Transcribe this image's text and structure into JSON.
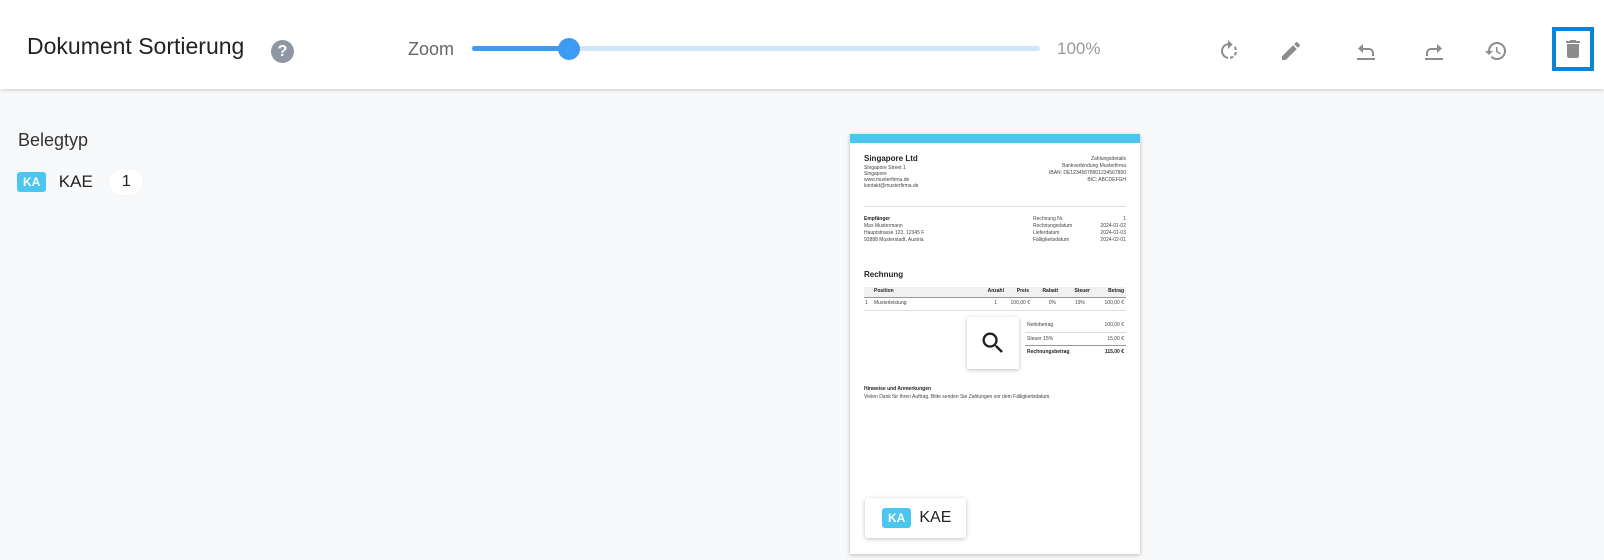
{
  "header": {
    "title": "Dokument Sortierung",
    "help_symbol": "?",
    "help_icon": "question-circle-icon",
    "zoom": {
      "label": "Zoom",
      "value_text": "100%",
      "slider_fraction": 0.17
    },
    "tools": [
      {
        "name": "rotate-icon"
      },
      {
        "name": "edit-pencil-icon"
      },
      {
        "name": "undo-icon"
      },
      {
        "name": "redo-icon"
      },
      {
        "name": "history-icon"
      },
      {
        "name": "delete-trash-icon"
      }
    ],
    "accent_color": "#3d9bf2",
    "highlight_color": "#0a84d6"
  },
  "sidebar": {
    "section_label": "Belegtyp",
    "types": [
      {
        "badge": "KA",
        "name": "KAE",
        "count": "1"
      }
    ],
    "badge_color": "#4cc6ee"
  },
  "document": {
    "page_tag": {
      "badge": "KA",
      "name": "KAE"
    },
    "zoom_icon": "magnifier-icon",
    "sender_name": "Singapore Ltd",
    "sender_lines": [
      "Singapore Street 1",
      "Singapore",
      "www.musterfirma.de",
      "kontakt@musterfirma.de"
    ],
    "sender_right_lines": [
      "Zahlungsdetails",
      "Bankverbindung Musterfirma",
      "IBAN: DE12345678901234567890",
      "BIC: ABCDEFGH"
    ],
    "recipient_label": "Empfänger",
    "recipient_lines": [
      "Max Mustermann",
      "Hauptstrasse 123, 12345 F",
      "92888 Musterstadt, Austria"
    ],
    "meta": [
      {
        "label": "Rechnung Nr.",
        "value": "1"
      },
      {
        "label": "Rechnungsdatum",
        "value": "2024-01-02"
      },
      {
        "label": "Lieferdatum",
        "value": "2024-01-03"
      },
      {
        "label": "Fälligkeitsdatum",
        "value": "2024-02-01"
      }
    ],
    "invoice_title": "Rechnung",
    "table_headers": [
      "Position",
      "Anzahl",
      "Preis",
      "Rabatt",
      "Steuer",
      "Betrag"
    ],
    "row": {
      "index": "1",
      "position": "Musterleistung",
      "anzahl": "1",
      "preis": "100,00 €",
      "rabatt": "0%",
      "steuer": "19%",
      "betrag": "100,00 €"
    },
    "totals": [
      {
        "label": "Nettobetrag",
        "value": "100,00 €"
      },
      {
        "label": "Steuer 15%",
        "value": "15,00 €"
      },
      {
        "label": "Rechnungsbetrag",
        "value": "115,00 €"
      }
    ],
    "notes_title": "Hinweise und Anmerkungen",
    "notes_text": "Vielen Dank für Ihren Auftrag. Bitte senden Sie Zahlungen vor dem Fälligkeitsdatum."
  }
}
